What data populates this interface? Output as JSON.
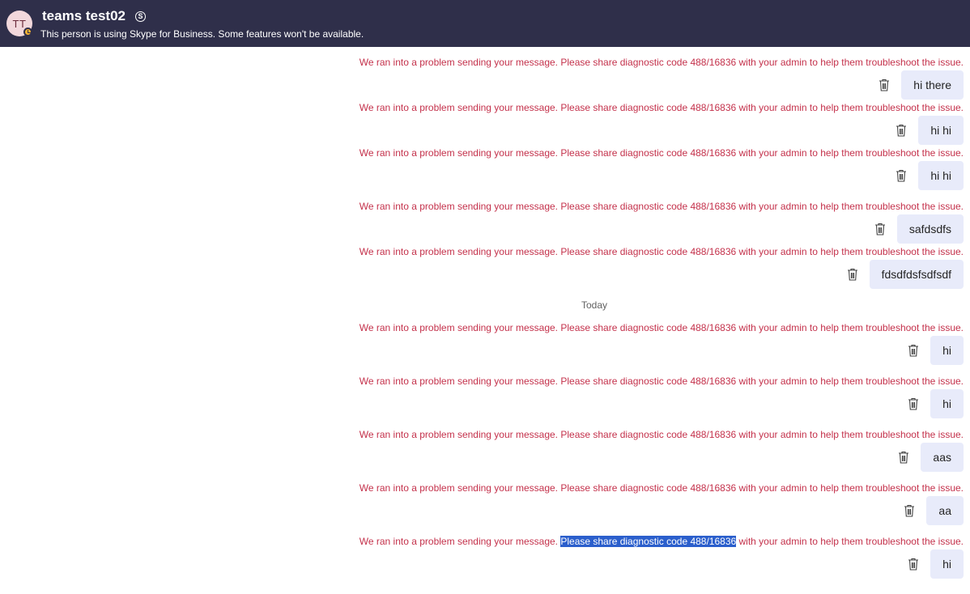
{
  "header": {
    "avatar_initials": "TT",
    "title": "teams test02",
    "skype_badge": "S",
    "subtitle": "This person is using Skype for Business. Some features won't be available."
  },
  "error": {
    "prefix": "We ran into a problem sending your message. ",
    "middle": "Please share diagnostic code 488/16836",
    "suffix": " with your admin to help them troubleshoot the issue."
  },
  "day_divider": "Today",
  "messages": [
    {
      "text": "hi there"
    },
    {
      "text": "hi hi"
    },
    {
      "text": "hi hi"
    },
    {
      "text": "safdsdfs"
    },
    {
      "text": "fdsdfdsfsdfsdf"
    },
    {
      "text": "hi"
    },
    {
      "text": "hi"
    },
    {
      "text": "aas"
    },
    {
      "text": "aa"
    },
    {
      "text": "hi",
      "selected_text": "Please share diagnostic code 488/16836"
    }
  ],
  "colors": {
    "header_bg": "#2f2f4a",
    "error_text": "#c4314b",
    "bubble_bg": "#e8ebfa",
    "selection_bg": "#2b5fcc"
  }
}
